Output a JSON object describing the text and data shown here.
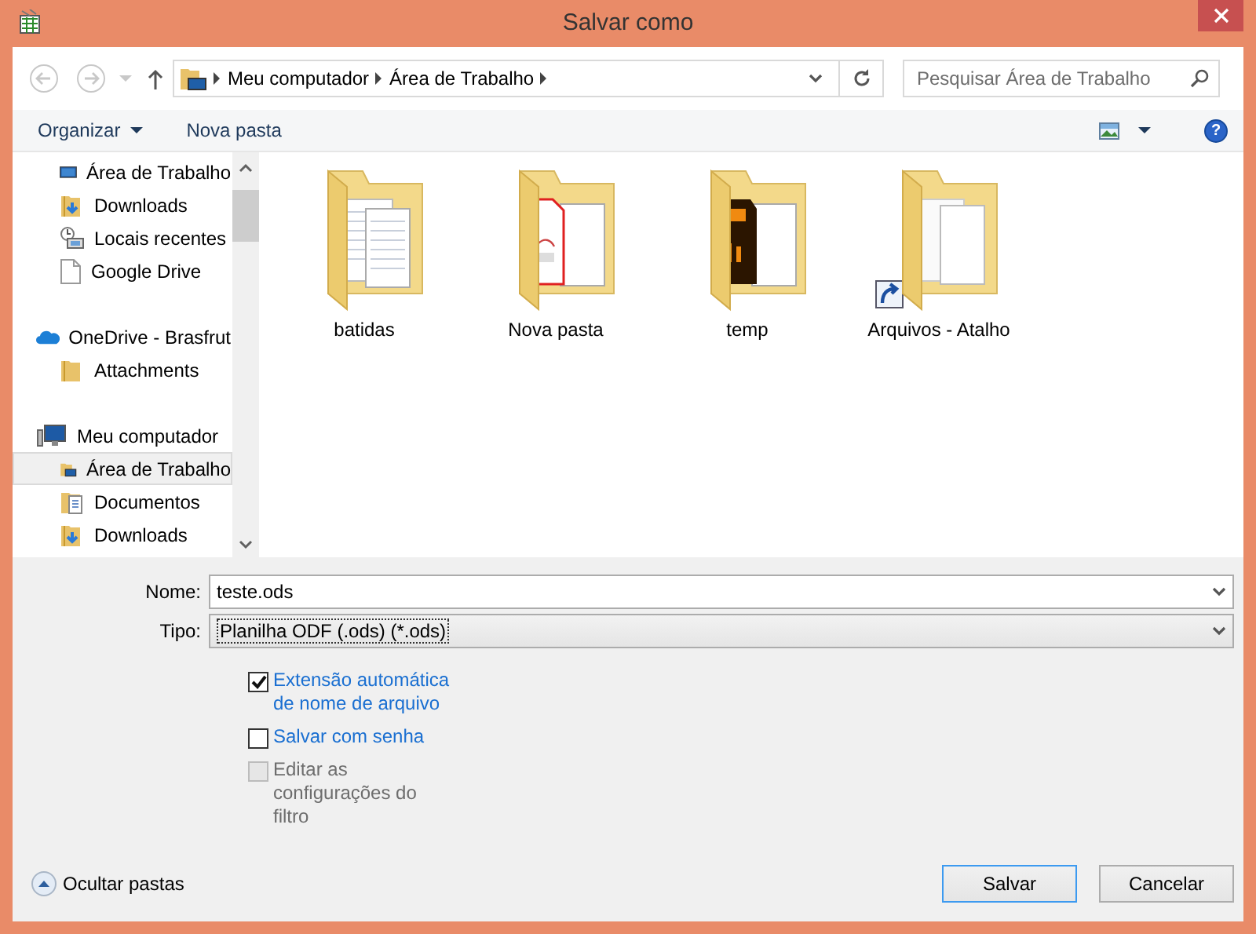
{
  "window": {
    "title": "Salvar como"
  },
  "address": {
    "path": [
      "Meu computador",
      "Área de Trabalho"
    ]
  },
  "search": {
    "placeholder": "Pesquisar Área de Trabalho"
  },
  "toolbar": {
    "organize": "Organizar",
    "new_folder": "Nova pasta",
    "help": "?"
  },
  "sidebar": {
    "tree": [
      {
        "children": [
          {
            "label": "Área de Trabalho",
            "kind": "desktop",
            "selected": false
          },
          {
            "label": "Downloads",
            "kind": "downloads",
            "selected": false
          },
          {
            "label": "Locais recentes",
            "kind": "recent",
            "selected": false
          },
          {
            "label": "Google Drive",
            "kind": "file",
            "selected": false
          }
        ]
      },
      {
        "label": "OneDrive - Brasfrut",
        "kind": "cloud",
        "selected": false,
        "children": [
          {
            "label": "Attachments",
            "kind": "folder",
            "selected": false
          }
        ]
      },
      {
        "label": "Meu computador",
        "kind": "computer",
        "selected": false,
        "children": [
          {
            "label": "Área de Trabalho",
            "kind": "desktop-folder",
            "selected": true
          },
          {
            "label": "Documentos",
            "kind": "documents",
            "selected": false
          },
          {
            "label": "Downloads",
            "kind": "downloads",
            "selected": false
          }
        ]
      }
    ]
  },
  "files": [
    {
      "name": "batidas",
      "kind": "documents"
    },
    {
      "name": "Nova pasta",
      "kind": "pdf"
    },
    {
      "name": "temp",
      "kind": "illustrator"
    },
    {
      "name": "Arquivos - Atalho",
      "kind": "shortcut"
    }
  ],
  "form": {
    "name": {
      "label": "Nome:",
      "value": "teste.ods"
    },
    "type": {
      "label": "Tipo:",
      "value": "Planilha ODF (.ods) (*.ods)"
    }
  },
  "options": [
    {
      "lines": [
        "Extensão automática",
        "de nome de arquivo"
      ],
      "checked": true,
      "disabled": false
    },
    {
      "lines": [
        "Salvar com senha"
      ],
      "checked": false,
      "disabled": false
    },
    {
      "lines": [
        "Editar as",
        "configurações do",
        "filtro"
      ],
      "checked": false,
      "disabled": true
    }
  ],
  "hide_folders": "Ocultar pastas",
  "buttons": [
    {
      "label": "Salvar",
      "default": true
    },
    {
      "label": "Cancelar",
      "default": false
    }
  ]
}
